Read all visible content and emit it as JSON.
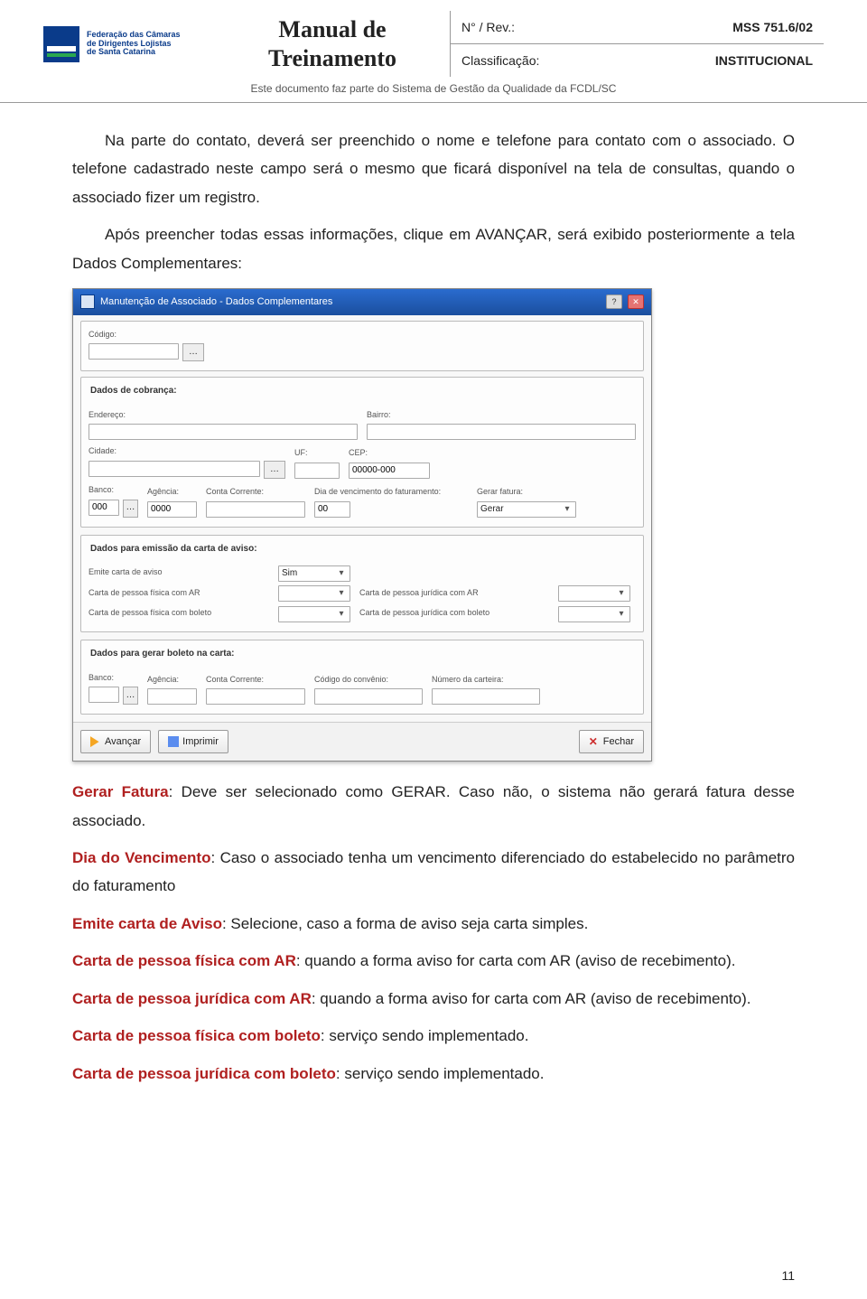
{
  "header": {
    "logo_lines": "Federação das Câmaras\nde Dirigentes Lojistas\nde Santa Catarina",
    "title_line1": "Manual de",
    "title_line2": "Treinamento",
    "rev_label": "N° / Rev.:",
    "rev_value": "MSS 751.6/02",
    "class_label": "Classificação:",
    "class_value": "INSTITUCIONAL",
    "subtitle": "Este documento faz parte do Sistema de Gestão da Qualidade da FCDL/SC"
  },
  "body": {
    "p1": "Na parte do contato, deverá ser preenchido o nome e telefone para contato com o associado. O telefone cadastrado neste campo será o mesmo que ficará disponível na tela de consultas, quando o associado fizer um registro.",
    "p2": "Após preencher todas essas informações, clique em AVANÇAR, será exibido posteriormente a tela Dados Complementares:",
    "gf_label": "Gerar Fatura",
    "gf_text": ": Deve ser selecionado como GERAR. Caso não, o sistema não gerará fatura desse associado.",
    "dv_label": "Dia do Vencimento",
    "dv_text": ": Caso o associado tenha um vencimento diferenciado do estabelecido no parâmetro do faturamento",
    "eca_label": "Emite carta de Aviso",
    "eca_text": ": Selecione, caso a forma de aviso seja carta simples.",
    "cpf_ar_label": "Carta de pessoa física com AR",
    "cpf_ar_text": ": quando a forma aviso for carta com AR (aviso de recebimento).",
    "cpj_ar_label": "Carta de pessoa jurídica com AR",
    "cpj_ar_text": ": quando a forma aviso for carta com AR (aviso de recebimento).",
    "cpf_bol_label": "Carta de pessoa física com boleto",
    "cpf_bol_text": ": serviço sendo implementado.",
    "cpj_bol_label": "Carta de pessoa jurídica com boleto",
    "cpj_bol_text": ": serviço sendo implementado."
  },
  "app": {
    "title": "Manutenção de Associado - Dados Complementares",
    "codigo_lbl": "Código:",
    "grp_cobranca": "Dados de cobrança:",
    "endereco_lbl": "Endereço:",
    "bairro_lbl": "Bairro:",
    "cidade_lbl": "Cidade:",
    "uf_lbl": "UF:",
    "cep_lbl": "CEP:",
    "cep_val": "00000-000",
    "banco_lbl": "Banco:",
    "banco_val": "000",
    "agencia_lbl": "Agência:",
    "agencia_val": "0000",
    "conta_lbl": "Conta Corrente:",
    "dia_venc_lbl": "Dia de vencimento do faturamento:",
    "dia_venc_val": "00",
    "gerar_fatura_lbl": "Gerar fatura:",
    "gerar_fatura_val": "Gerar",
    "grp_carta": "Dados para emissão da carta de aviso:",
    "emite_lbl": "Emite carta de aviso",
    "emite_val": "Sim",
    "cpf_ar_lbl": "Carta de pessoa física com AR",
    "cpj_ar_lbl": "Carta de pessoa jurídica com AR",
    "cpf_bol_lbl": "Carta de pessoa física com boleto",
    "cpj_bol_lbl": "Carta de pessoa jurídica com boleto",
    "grp_boleto": "Dados para gerar boleto na carta:",
    "codigo_conv_lbl": "Código do convênio:",
    "num_cart_lbl": "Número da carteira:",
    "btn_avancar": "Avançar",
    "btn_imprimir": "Imprimir",
    "btn_fechar": "Fechar"
  },
  "page_number": "11"
}
